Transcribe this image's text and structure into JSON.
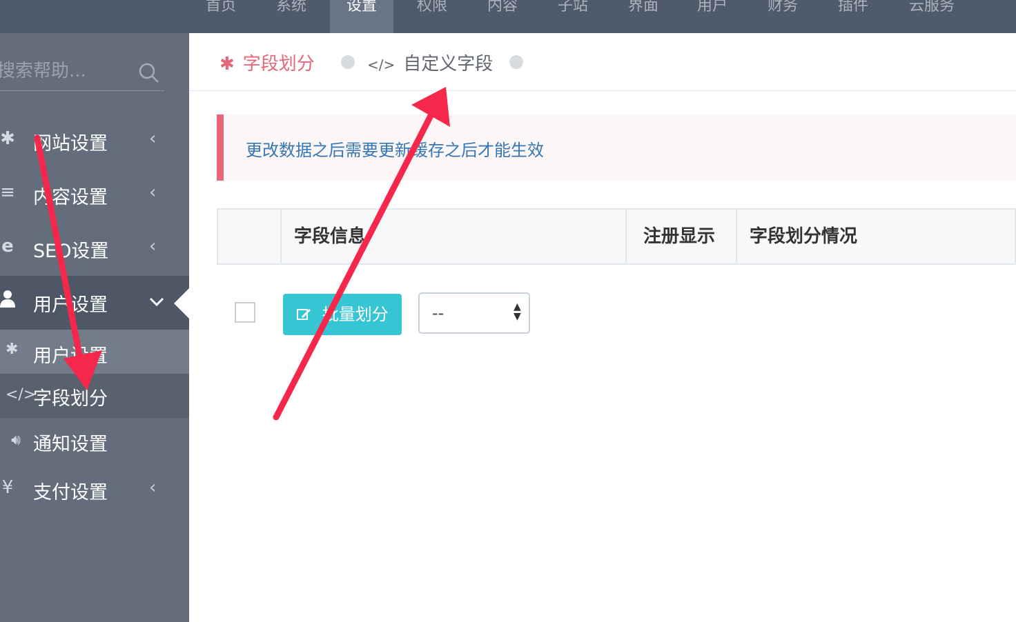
{
  "topnav": {
    "items": [
      {
        "label": "首页"
      },
      {
        "label": "系统"
      },
      {
        "label": "设置"
      },
      {
        "label": "权限"
      },
      {
        "label": "内容"
      },
      {
        "label": "子站"
      },
      {
        "label": "界面"
      },
      {
        "label": "用户"
      },
      {
        "label": "财务"
      },
      {
        "label": "插件"
      },
      {
        "label": "云服务"
      }
    ],
    "active": "设置"
  },
  "sidebar": {
    "search_placeholder": "搜索帮助...",
    "items": [
      {
        "label": "网站设置",
        "icon": "gear-icon"
      },
      {
        "label": "内容设置",
        "icon": "list-icon"
      },
      {
        "label": "SEO设置",
        "icon": "e-icon"
      },
      {
        "label": "用户设置",
        "icon": "user-icon"
      },
      {
        "label": "支付设置",
        "icon": "yen-icon"
      }
    ],
    "subitems": [
      {
        "label": "用户设置",
        "icon": "gear-icon"
      },
      {
        "label": "字段划分",
        "icon": "code-icon"
      },
      {
        "label": "通知设置",
        "icon": "volume-icon"
      }
    ]
  },
  "main": {
    "tabs": [
      {
        "label": "字段划分",
        "icon": "gear-icon"
      },
      {
        "label": "自定义字段",
        "icon": "code-icon"
      }
    ],
    "alert": "更改数据之后需要更新缓存之后才能生效",
    "table": {
      "headers": [
        "字段信息",
        "注册显示",
        "字段划分情况"
      ]
    },
    "batch_button": "批量划分",
    "select_value": "--",
    "colors": {
      "accent": "#e6677a",
      "button": "#36c6d3",
      "arrow": "#f5274a"
    }
  }
}
